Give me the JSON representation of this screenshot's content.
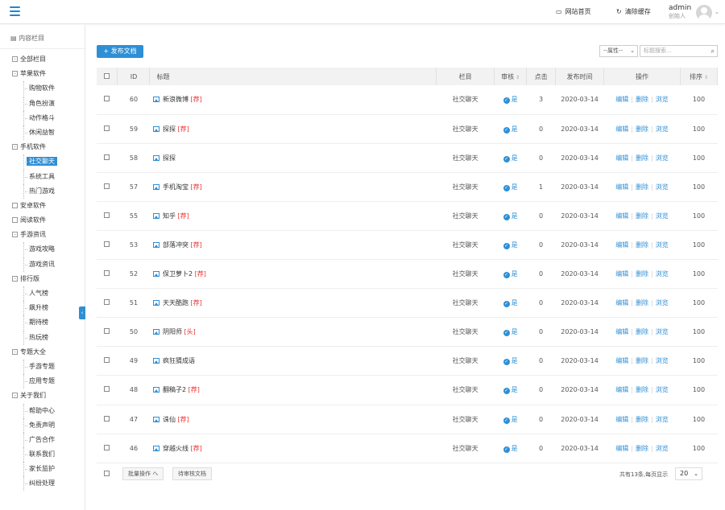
{
  "topbar": {
    "site_home": "网站首页",
    "clear_cache": "清除缓存",
    "user_name": "admin",
    "user_role": "创始人"
  },
  "sidebar": {
    "title": "内容栏目",
    "items": [
      {
        "label": "全部栏目",
        "level": 1,
        "box": "-"
      },
      {
        "label": "苹果软件",
        "level": 1,
        "box": "-"
      },
      {
        "label": "购物软件",
        "level": 2
      },
      {
        "label": "角色扮演",
        "level": 2
      },
      {
        "label": "动作格斗",
        "level": 2
      },
      {
        "label": "休闲益智",
        "level": 2
      },
      {
        "label": "手机软件",
        "level": 1,
        "box": "-"
      },
      {
        "label": "社交聊天",
        "level": 2,
        "selected": true
      },
      {
        "label": "系统工具",
        "level": 2
      },
      {
        "label": "热门游戏",
        "level": 2
      },
      {
        "label": "安卓软件",
        "level": 1
      },
      {
        "label": "阅读软件",
        "level": 1
      },
      {
        "label": "手游资讯",
        "level": 1,
        "box": "-"
      },
      {
        "label": "游戏攻略",
        "level": 2
      },
      {
        "label": "游戏资讯",
        "level": 2
      },
      {
        "label": "排行版",
        "level": 1,
        "box": "-"
      },
      {
        "label": "人气榜",
        "level": 2
      },
      {
        "label": "飙升榜",
        "level": 2
      },
      {
        "label": "期待榜",
        "level": 2
      },
      {
        "label": "热玩榜",
        "level": 2
      },
      {
        "label": "专题大全",
        "level": 1,
        "box": "-"
      },
      {
        "label": "手游专题",
        "level": 2
      },
      {
        "label": "应用专题",
        "level": 2
      },
      {
        "label": "关于我们",
        "level": 1,
        "box": "-"
      },
      {
        "label": "帮助中心",
        "level": 2
      },
      {
        "label": "免责声明",
        "level": 2
      },
      {
        "label": "广告合作",
        "level": 2
      },
      {
        "label": "联系我们",
        "level": 2
      },
      {
        "label": "家长监护",
        "level": 2
      },
      {
        "label": "纠纷处理",
        "level": 2
      }
    ]
  },
  "toolbar": {
    "add_label": "+ 发布文档",
    "attr_select": "--属性--",
    "search_placeholder": "标题搜索..."
  },
  "table": {
    "headers": {
      "id": "ID",
      "title": "标题",
      "column": "栏目",
      "audit": "审核",
      "hits": "点击",
      "date": "发布时间",
      "ops": "操作",
      "order": "排序"
    },
    "op_labels": {
      "edit": "编辑",
      "delete": "删除",
      "view": "浏览"
    },
    "rows": [
      {
        "id": "60",
        "title": "新浪微博",
        "tag": "[荐]",
        "column": "社交聊天",
        "audit": "是",
        "hits": "3",
        "date": "2020-03-14",
        "order": "100"
      },
      {
        "id": "59",
        "title": "探探",
        "tag": "[荐]",
        "column": "社交聊天",
        "audit": "是",
        "hits": "0",
        "date": "2020-03-14",
        "order": "100"
      },
      {
        "id": "58",
        "title": "探探",
        "tag": "",
        "column": "社交聊天",
        "audit": "是",
        "hits": "0",
        "date": "2020-03-14",
        "order": "100"
      },
      {
        "id": "57",
        "title": "手机淘宝",
        "tag": "[荐]",
        "column": "社交聊天",
        "audit": "是",
        "hits": "1",
        "date": "2020-03-14",
        "order": "100"
      },
      {
        "id": "55",
        "title": "知乎",
        "tag": "[荐]",
        "column": "社交聊天",
        "audit": "是",
        "hits": "0",
        "date": "2020-03-14",
        "order": "100"
      },
      {
        "id": "53",
        "title": "部落冲突",
        "tag": "[荐]",
        "column": "社交聊天",
        "audit": "是",
        "hits": "0",
        "date": "2020-03-14",
        "order": "100"
      },
      {
        "id": "52",
        "title": "保卫萝卜2",
        "tag": "[荐]",
        "column": "社交聊天",
        "audit": "是",
        "hits": "0",
        "date": "2020-03-14",
        "order": "100"
      },
      {
        "id": "51",
        "title": "天天酷跑",
        "tag": "[荐]",
        "column": "社交聊天",
        "audit": "是",
        "hits": "0",
        "date": "2020-03-14",
        "order": "100"
      },
      {
        "id": "50",
        "title": "阴阳师",
        "tag": "[头]",
        "column": "社交聊天",
        "audit": "是",
        "hits": "0",
        "date": "2020-03-14",
        "order": "100"
      },
      {
        "id": "49",
        "title": "疯狂猜成语",
        "tag": "",
        "column": "社交聊天",
        "audit": "是",
        "hits": "0",
        "date": "2020-03-14",
        "order": "100"
      },
      {
        "id": "48",
        "title": "翻稿子2",
        "tag": "[荐]",
        "column": "社交聊天",
        "audit": "是",
        "hits": "0",
        "date": "2020-03-14",
        "order": "100"
      },
      {
        "id": "47",
        "title": "诛仙",
        "tag": "[荐]",
        "column": "社交聊天",
        "audit": "是",
        "hits": "0",
        "date": "2020-03-14",
        "order": "100"
      },
      {
        "id": "46",
        "title": "穿越火线",
        "tag": "[荐]",
        "column": "社交聊天",
        "audit": "是",
        "hits": "0",
        "date": "2020-03-14",
        "order": "100"
      }
    ]
  },
  "footer": {
    "batch_ops": "批量操作 へ",
    "pending_audit": "待审核文档",
    "summary": "共有13条,每页显示",
    "page_size": "20"
  }
}
